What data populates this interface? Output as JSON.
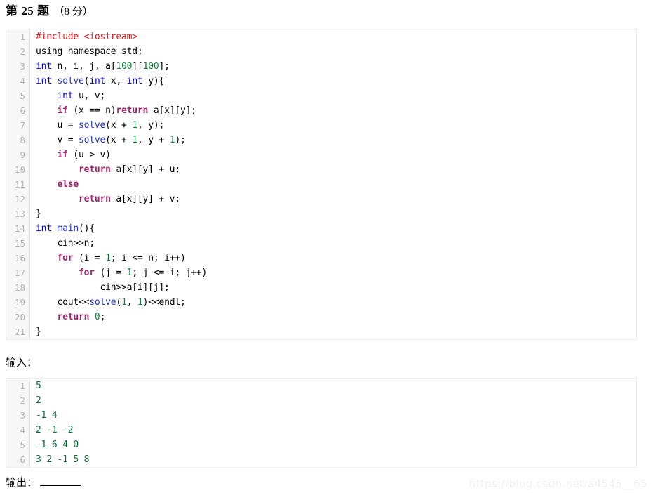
{
  "header": {
    "question_label": "第 25 题",
    "score_label": "（8 分）"
  },
  "code_block": {
    "language": "cpp",
    "lines": [
      {
        "n": "1",
        "text": "#include <iostream>"
      },
      {
        "n": "2",
        "text": "using namespace std;"
      },
      {
        "n": "3",
        "text": "int n, i, j, a[100][100];"
      },
      {
        "n": "4",
        "text": "int solve(int x, int y){"
      },
      {
        "n": "5",
        "text": "    int u, v;"
      },
      {
        "n": "6",
        "text": "    if (x == n)return a[x][y];"
      },
      {
        "n": "7",
        "text": "    u = solve(x + 1, y);"
      },
      {
        "n": "8",
        "text": "    v = solve(x + 1, y + 1);"
      },
      {
        "n": "9",
        "text": "    if (u > v)"
      },
      {
        "n": "10",
        "text": "        return a[x][y] + u;"
      },
      {
        "n": "11",
        "text": "    else"
      },
      {
        "n": "12",
        "text": "        return a[x][y] + v;"
      },
      {
        "n": "13",
        "text": "}"
      },
      {
        "n": "14",
        "text": "int main(){"
      },
      {
        "n": "15",
        "text": "    cin>>n;"
      },
      {
        "n": "16",
        "text": "    for (i = 1; i <= n; i++)"
      },
      {
        "n": "17",
        "text": "        for (j = 1; j <= i; j++)"
      },
      {
        "n": "18",
        "text": "            cin>>a[i][j];"
      },
      {
        "n": "19",
        "text": "    cout<<solve(1, 1)<<endl;"
      },
      {
        "n": "20",
        "text": "    return 0;"
      },
      {
        "n": "21",
        "text": "}"
      }
    ]
  },
  "input_section": {
    "label": "输入：",
    "lines": [
      {
        "n": "1",
        "text": "5"
      },
      {
        "n": "2",
        "text": "2"
      },
      {
        "n": "3",
        "text": "-1 4"
      },
      {
        "n": "4",
        "text": "2 -1 -2"
      },
      {
        "n": "5",
        "text": "-1 6 4 0"
      },
      {
        "n": "6",
        "text": "3 2 -1 5 8"
      }
    ]
  },
  "output_section": {
    "label": "输出：",
    "answer_value": ""
  },
  "watermark": {
    "text": "https://blog.csdn.net/a4545__65"
  },
  "colors": {
    "preprocessor": "#e81b1b",
    "keyword": "#a0256e",
    "type": "#0000dd",
    "function": "#2233cc",
    "number": "#107a36",
    "gutter_text": "#b6b6b6",
    "gutter_bg": "#f7f7f7",
    "border": "#ededed",
    "watermark": "#f1f1f1"
  }
}
